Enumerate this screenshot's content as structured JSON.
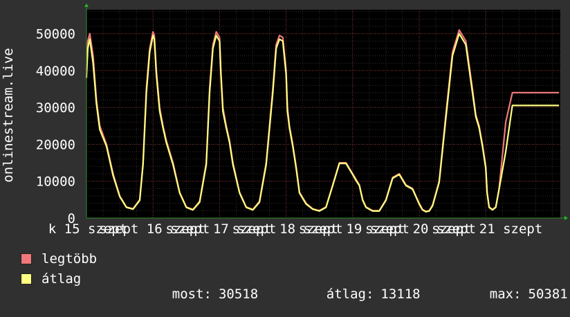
{
  "chart_data": {
    "type": "line",
    "ylabel": "onlinestream.live",
    "ylim": [
      0,
      56500
    ],
    "yticks": [
      0,
      10000,
      20000,
      30000,
      40000,
      50000
    ],
    "xlim": [
      0,
      7.12
    ],
    "day_labels": [
      {
        "pos": 0.0,
        "text": "k 15 szept"
      },
      {
        "pos": 1.0,
        "text": "szept 16 szept"
      },
      {
        "pos": 2.0,
        "text": "szept 17 szept"
      },
      {
        "pos": 3.0,
        "text": "szept 18 szept"
      },
      {
        "pos": 4.0,
        "text": "szept 19 szept"
      },
      {
        "pos": 5.0,
        "text": "szept 20 szept"
      },
      {
        "pos": 6.0,
        "text": "szept 21 szept"
      }
    ],
    "grid": true,
    "background": "#000000",
    "grid_color": "#5a1e1e",
    "series": [
      {
        "name": "legtöbb",
        "color": "#f0787a",
        "x": [
          0.0,
          0.02,
          0.05,
          0.1,
          0.15,
          0.2,
          0.3,
          0.4,
          0.5,
          0.6,
          0.7,
          0.8,
          0.85,
          0.9,
          0.95,
          1.0,
          1.02,
          1.05,
          1.1,
          1.15,
          1.2,
          1.3,
          1.4,
          1.5,
          1.6,
          1.7,
          1.8,
          1.85,
          1.9,
          1.95,
          2.0,
          2.02,
          2.05,
          2.1,
          2.15,
          2.2,
          2.3,
          2.4,
          2.5,
          2.6,
          2.7,
          2.8,
          2.85,
          2.9,
          2.95,
          3.0,
          3.02,
          3.05,
          3.1,
          3.15,
          3.2,
          3.3,
          3.4,
          3.5,
          3.6,
          3.7,
          3.8,
          3.9,
          4.0,
          4.05,
          4.1,
          4.15,
          4.2,
          4.3,
          4.4,
          4.5,
          4.6,
          4.7,
          4.8,
          4.9,
          5.0,
          5.05,
          5.1,
          5.15,
          5.2,
          5.3,
          5.4,
          5.5,
          5.6,
          5.7,
          5.8,
          5.85,
          5.9,
          5.95,
          6.0,
          6.02,
          6.05,
          6.1,
          6.15,
          6.2,
          6.3,
          6.4,
          6.5,
          6.6,
          6.7,
          6.8,
          6.85,
          6.9,
          6.95,
          7.0,
          7.03,
          7.06,
          7.08,
          7.1
        ],
        "values": [
          40000,
          48000,
          50000,
          44000,
          32000,
          25000,
          20000,
          12000,
          6000,
          3000,
          2500,
          5000,
          15000,
          35000,
          46000,
          50500,
          49500,
          40000,
          30000,
          25000,
          21000,
          15000,
          7000,
          3000,
          2300,
          4500,
          15000,
          35000,
          47000,
          50500,
          49000,
          40000,
          30000,
          25000,
          21000,
          15000,
          7000,
          3000,
          2300,
          4500,
          15000,
          35000,
          47000,
          49500,
          49000,
          40000,
          30000,
          25000,
          20000,
          14000,
          7000,
          4000,
          2500,
          2000,
          3000,
          9000,
          15000,
          15000,
          12000,
          10500,
          9000,
          5000,
          3000,
          2000,
          2000,
          5000,
          11000,
          12000,
          9000,
          8000,
          4000,
          2300,
          1800,
          2000,
          3500,
          10000,
          28000,
          45000,
          51000,
          48000,
          35000,
          28000,
          25000,
          20000,
          14000,
          7000,
          3000,
          2300,
          3000,
          8000,
          26000,
          34000,
          34000,
          34000,
          34000,
          34000,
          34000,
          34000,
          34000,
          34000,
          34000,
          34000,
          34000,
          34000
        ]
      },
      {
        "name": "átlag",
        "color": "#ffff80",
        "x": [
          0.0,
          0.02,
          0.05,
          0.1,
          0.15,
          0.2,
          0.3,
          0.4,
          0.5,
          0.6,
          0.7,
          0.8,
          0.85,
          0.9,
          0.95,
          1.0,
          1.02,
          1.05,
          1.1,
          1.15,
          1.2,
          1.3,
          1.4,
          1.5,
          1.6,
          1.7,
          1.8,
          1.85,
          1.9,
          1.95,
          2.0,
          2.02,
          2.05,
          2.1,
          2.15,
          2.2,
          2.3,
          2.4,
          2.5,
          2.6,
          2.7,
          2.8,
          2.85,
          2.9,
          2.95,
          3.0,
          3.02,
          3.05,
          3.1,
          3.15,
          3.2,
          3.3,
          3.4,
          3.5,
          3.6,
          3.7,
          3.8,
          3.9,
          4.0,
          4.05,
          4.1,
          4.15,
          4.2,
          4.3,
          4.4,
          4.5,
          4.6,
          4.7,
          4.8,
          4.9,
          5.0,
          5.05,
          5.1,
          5.15,
          5.2,
          5.3,
          5.4,
          5.5,
          5.6,
          5.7,
          5.8,
          5.85,
          5.9,
          5.95,
          6.0,
          6.02,
          6.05,
          6.1,
          6.15,
          6.2,
          6.3,
          6.4,
          6.5,
          6.6,
          6.7,
          6.8,
          6.85,
          6.9,
          6.95,
          7.0,
          7.03,
          7.06,
          7.08,
          7.1
        ],
        "values": [
          38000,
          46000,
          48500,
          42000,
          31000,
          24000,
          19500,
          11500,
          5800,
          2900,
          2400,
          4800,
          14500,
          34000,
          45000,
          49500,
          48500,
          39000,
          29000,
          24500,
          20500,
          14500,
          6800,
          2900,
          2200,
          4300,
          14500,
          34000,
          46000,
          49500,
          48000,
          39000,
          29000,
          24500,
          20500,
          14500,
          6800,
          2900,
          2200,
          4300,
          14500,
          34000,
          46000,
          48500,
          48000,
          39000,
          29000,
          24500,
          19500,
          13500,
          6800,
          3800,
          2400,
          1900,
          2900,
          8800,
          14800,
          14800,
          11800,
          10200,
          8800,
          4800,
          2900,
          1900,
          1900,
          4800,
          10800,
          11800,
          8800,
          7800,
          3800,
          2200,
          1700,
          1900,
          3300,
          9700,
          27000,
          44000,
          50000,
          47000,
          34000,
          27500,
          24500,
          19500,
          13500,
          6800,
          2900,
          2200,
          2900,
          7800,
          18000,
          30518,
          30518,
          30518,
          30518,
          30518,
          30518,
          30518,
          30518,
          30518,
          30518,
          30518,
          30518,
          30518
        ]
      }
    ]
  },
  "legend": [
    {
      "label": "legtöbb",
      "color": "#f0787a"
    },
    {
      "label": "átlag",
      "color": "#ffff80"
    }
  ],
  "stats": {
    "most_label": "most:",
    "most_value": "30518",
    "atlag_label": "átlag:",
    "atlag_value": "13118",
    "max_label": "max:",
    "max_value": "50381"
  }
}
